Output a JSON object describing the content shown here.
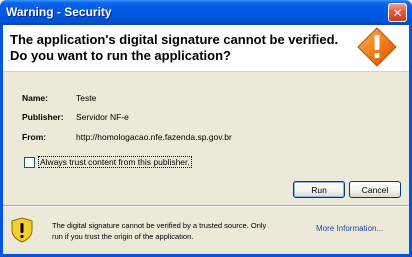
{
  "window": {
    "title": "Warning - Security",
    "close_glyph": "✕"
  },
  "header": {
    "line1": "The application's digital signature cannot be verified.",
    "line2": "Do you want to run the application?",
    "icon": "warning-icon"
  },
  "details": {
    "name_label": "Name:",
    "name_value": "Teste",
    "publisher_label": "Publisher:",
    "publisher_value": "Servidor NF-e",
    "from_label": "From:",
    "from_value": "http://homologacao.nfe.fazenda.sp.gov.br"
  },
  "trust_checkbox": {
    "label": "Always trust content from this publisher.",
    "checked": false
  },
  "buttons": {
    "run": "Run",
    "cancel": "Cancel"
  },
  "footer": {
    "icon": "shield-warning-icon",
    "line1": "The digital signature cannot be verified by a trusted source.  Only",
    "line2": "run if you trust the origin of the application.",
    "more_info": "More Information..."
  },
  "colors": {
    "titlebar": "#0058e6",
    "warning_orange": "#f07a14",
    "link": "#1f4aa5"
  }
}
